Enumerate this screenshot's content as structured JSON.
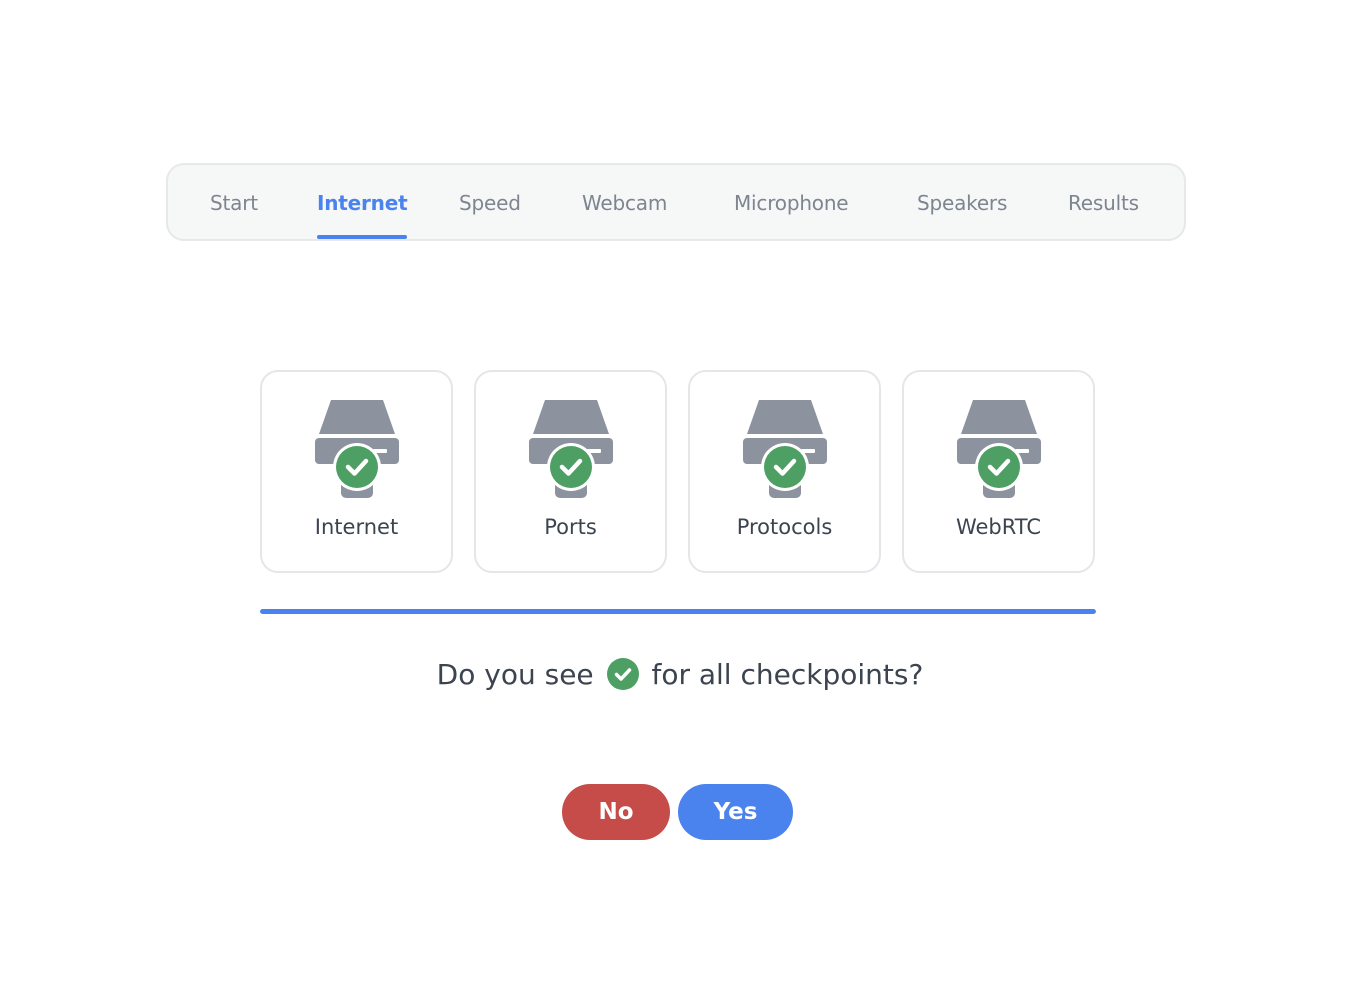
{
  "tabs": [
    {
      "label": "Start",
      "active": false
    },
    {
      "label": "Internet",
      "active": true
    },
    {
      "label": "Speed",
      "active": false
    },
    {
      "label": "Webcam",
      "active": false
    },
    {
      "label": "Microphone",
      "active": false
    },
    {
      "label": "Speakers",
      "active": false
    },
    {
      "label": "Results",
      "active": false
    }
  ],
  "checkpoints": [
    {
      "label": "Internet",
      "icon": "server-check-icon",
      "status": "passed"
    },
    {
      "label": "Ports",
      "icon": "server-check-icon",
      "status": "passed"
    },
    {
      "label": "Protocols",
      "icon": "server-check-icon",
      "status": "passed"
    },
    {
      "label": "WebRTC",
      "icon": "server-check-icon",
      "status": "passed"
    }
  ],
  "progress": {
    "fraction": 1.0
  },
  "question": {
    "before": "Do you see",
    "icon": "green-check-icon",
    "after": "for all checkpoints?"
  },
  "buttons": {
    "no_label": "No",
    "yes_label": "Yes"
  },
  "colors": {
    "accent": "#4a83ee",
    "success": "#4d9f63",
    "danger": "#c64c49",
    "icon_gray": "#8c939e",
    "tab_inactive": "#7d8590",
    "text": "#3c4450"
  }
}
